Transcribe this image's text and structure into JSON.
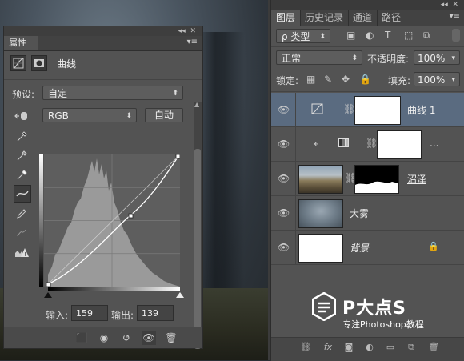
{
  "properties": {
    "tab_label": "属性",
    "title": "曲线",
    "preset_label": "预设:",
    "preset_value": "自定",
    "channel_value": "RGB",
    "auto_button": "自动",
    "input_label": "输入:",
    "input_value": "159",
    "output_label": "输出:",
    "output_value": "139"
  },
  "layers_panel": {
    "tabs": [
      "图层",
      "历史记录",
      "通道",
      "路径"
    ],
    "filter_value": "ρ 类型",
    "blend_mode": "正常",
    "opacity_label": "不透明度:",
    "opacity_value": "100%",
    "lock_label": "锁定:",
    "fill_label": "填充:",
    "fill_value": "100%",
    "layers": [
      {
        "name": "曲线 1",
        "type": "adjustment",
        "selected": true
      },
      {
        "name": "...",
        "type": "clipped",
        "selected": false
      },
      {
        "name": "沼泽",
        "type": "masked-image",
        "selected": false
      },
      {
        "name": "大雾",
        "type": "image",
        "selected": false
      },
      {
        "name": "背景",
        "type": "background",
        "selected": false,
        "locked": true
      }
    ]
  },
  "watermark": {
    "title": "P大点S",
    "subtitle": "专注Photoshop教程"
  },
  "colors": {
    "panel_bg": "#535353",
    "selected_layer": "#5a6b80",
    "tab_bar": "#424242"
  }
}
